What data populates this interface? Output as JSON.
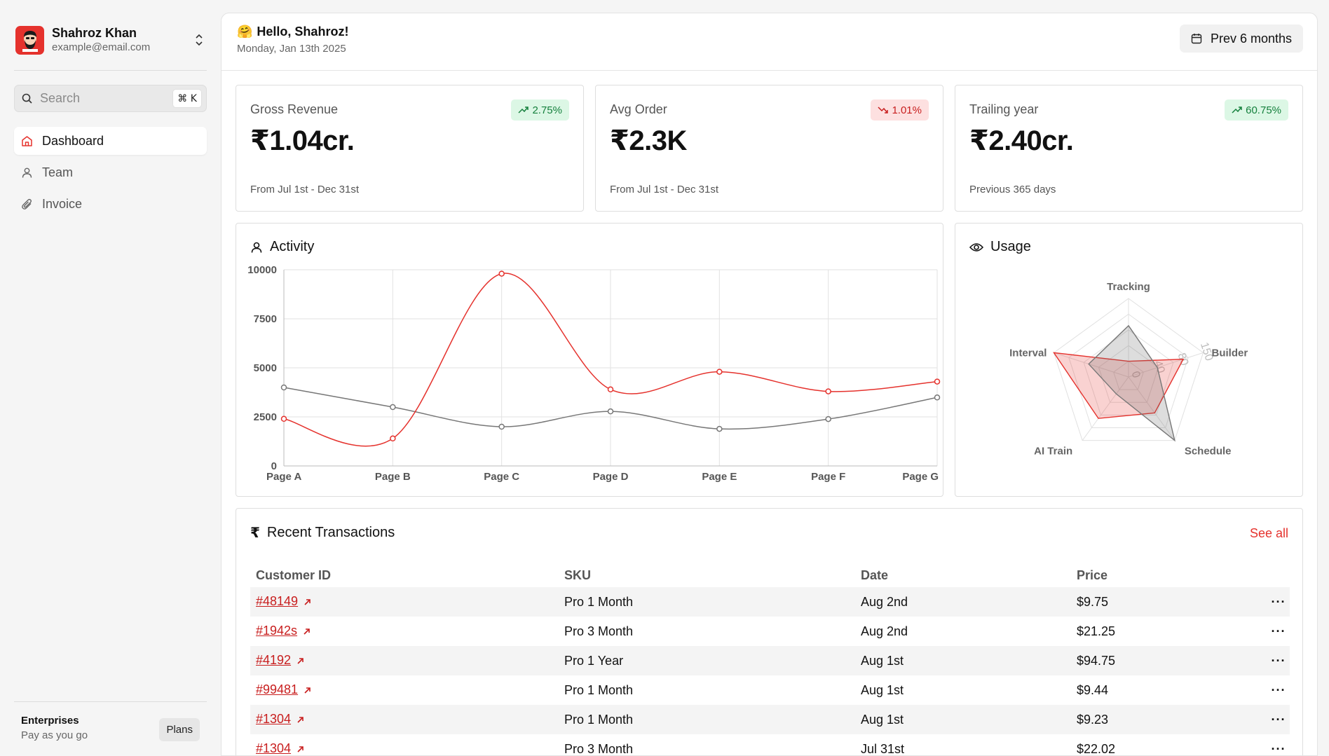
{
  "user": {
    "name": "Shahroz Khan",
    "email": "example@email.com"
  },
  "sidebar": {
    "search_placeholder": "Search",
    "shortcut_key": "⌘ K",
    "nav": [
      {
        "label": "Dashboard",
        "icon": "home-icon",
        "active": true
      },
      {
        "label": "Team",
        "icon": "user-icon",
        "active": false
      },
      {
        "label": "Invoice",
        "icon": "paperclip-icon",
        "active": false
      }
    ],
    "plan": {
      "title": "Enterprises",
      "subtitle": "Pay as you go",
      "button": "Plans"
    }
  },
  "header": {
    "greeting_emoji": "🤗",
    "greeting": "Hello, Shahroz!",
    "date": "Monday, Jan 13th 2025",
    "range_button": "Prev 6 months"
  },
  "stats": [
    {
      "label": "Gross Revenue",
      "value": "₹1.04cr.",
      "badge": "2.75%",
      "trend": "up",
      "sub": "From Jul 1st - Dec 31st"
    },
    {
      "label": "Avg Order",
      "value": "₹2.3K",
      "badge": "1.01%",
      "trend": "down",
      "sub": "From Jul 1st - Dec 31st"
    },
    {
      "label": "Trailing year",
      "value": "₹2.40cr.",
      "badge": "60.75%",
      "trend": "up",
      "sub": "Previous 365 days"
    }
  ],
  "activity": {
    "title": "Activity"
  },
  "usage": {
    "title": "Usage"
  },
  "colors": {
    "accent_red": "#e5322d",
    "series_gray": "#777777",
    "badge_up_bg": "#dcf7e5",
    "badge_down_bg": "#fde0e0"
  },
  "chart_data": [
    {
      "type": "line",
      "categories": [
        "Page A",
        "Page B",
        "Page C",
        "Page D",
        "Page E",
        "Page F",
        "Page G"
      ],
      "series": [
        {
          "color": "#e5322d",
          "values": [
            2400,
            1400,
            9800,
            3900,
            4800,
            3800,
            4300
          ]
        },
        {
          "color": "#777777",
          "values": [
            4000,
            3000,
            2000,
            2780,
            1890,
            2390,
            3490
          ]
        }
      ],
      "yticks": [
        0,
        2500,
        5000,
        7500,
        10000
      ],
      "ylim": [
        0,
        10000
      ],
      "grid": true
    },
    {
      "type": "radar",
      "axes": [
        "Tracking",
        "Builder",
        "Schedule",
        "AI Train",
        "Interval"
      ],
      "radial_ticks": [
        "0",
        "40",
        "80",
        "150"
      ],
      "rmax": 150,
      "series": [
        {
          "color": "#e5322d",
          "values": [
            30,
            110,
            85,
            98,
            150
          ]
        },
        {
          "color": "#777777",
          "values": [
            98,
            58,
            150,
            40,
            80
          ]
        }
      ]
    }
  ],
  "transactions": {
    "title": "Recent Transactions",
    "see_all": "See all",
    "columns": [
      "Customer ID",
      "SKU",
      "Date",
      "Price"
    ],
    "rows": [
      {
        "id": "#48149",
        "sku": "Pro 1 Month",
        "date": "Aug 2nd",
        "price": "$9.75"
      },
      {
        "id": "#1942s",
        "sku": "Pro 3 Month",
        "date": "Aug 2nd",
        "price": "$21.25"
      },
      {
        "id": "#4192",
        "sku": "Pro 1 Year",
        "date": "Aug 1st",
        "price": "$94.75"
      },
      {
        "id": "#99481",
        "sku": "Pro 1 Month",
        "date": "Aug 1st",
        "price": "$9.44"
      },
      {
        "id": "#1304",
        "sku": "Pro 1 Month",
        "date": "Aug 1st",
        "price": "$9.23"
      },
      {
        "id": "#1304",
        "sku": "Pro 3 Month",
        "date": "Jul 31st",
        "price": "$22.02"
      }
    ],
    "row_action": "···"
  }
}
